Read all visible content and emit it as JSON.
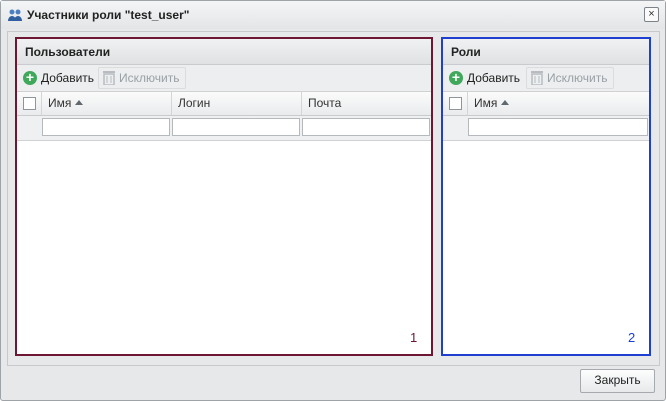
{
  "window": {
    "title": "Участники роли \"test_user\"",
    "close_glyph": "×"
  },
  "users_panel": {
    "title": "Пользователи",
    "add_label": "Добавить",
    "remove_label": "Исключить",
    "columns": [
      "Имя",
      "Логин",
      "Почта"
    ],
    "badge": "1",
    "border_color": "#6d1733"
  },
  "roles_panel": {
    "title": "Роли",
    "add_label": "Добавить",
    "remove_label": "Исключить",
    "columns": [
      "Имя"
    ],
    "badge": "2",
    "border_color": "#1f3fd1"
  },
  "footer": {
    "close_label": "Закрыть"
  },
  "icons": {
    "title": "users-group-icon",
    "add": "plus-circle-icon",
    "remove": "trash-icon",
    "sort": "sort-asc-icon"
  }
}
